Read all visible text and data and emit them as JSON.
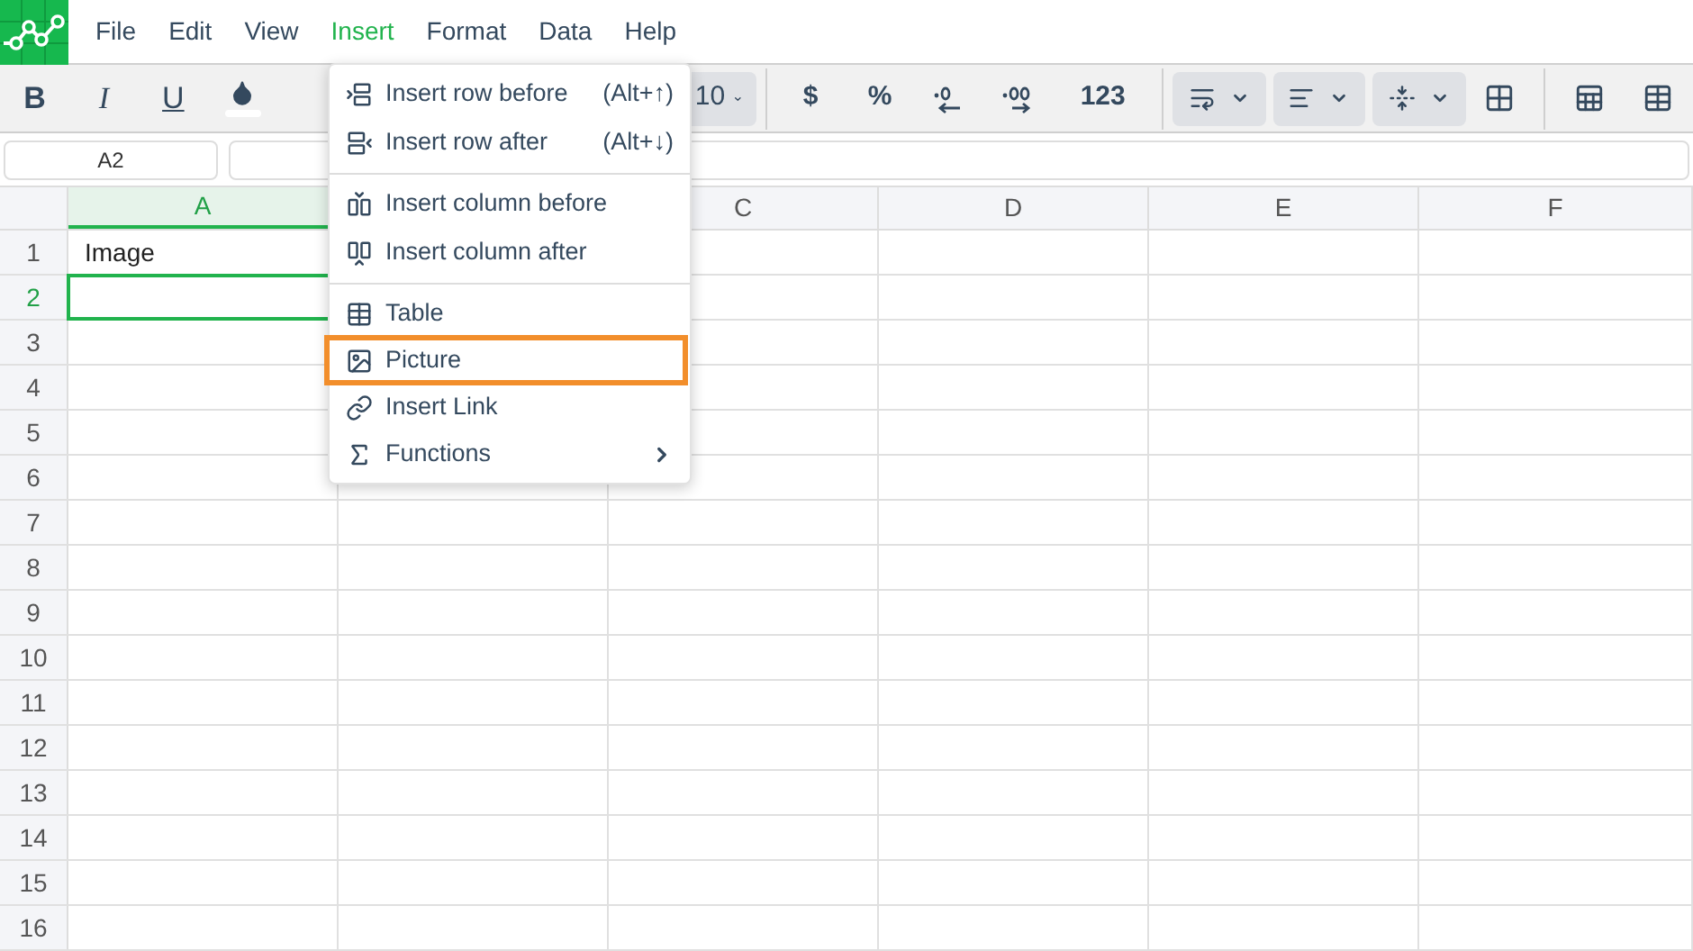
{
  "menubar": [
    {
      "label": "File",
      "selected": false
    },
    {
      "label": "Edit",
      "selected": false
    },
    {
      "label": "View",
      "selected": false
    },
    {
      "label": "Insert",
      "selected": true
    },
    {
      "label": "Format",
      "selected": false
    },
    {
      "label": "Data",
      "selected": false
    },
    {
      "label": "Help",
      "selected": false
    }
  ],
  "toolbar": [
    {
      "kind": "bold",
      "label": "B"
    },
    {
      "kind": "italic",
      "label": "I"
    },
    {
      "kind": "underline",
      "label": "U"
    },
    {
      "kind": "fill"
    },
    {
      "kind": "font-size",
      "label": "10"
    },
    {
      "kind": "separator"
    },
    {
      "kind": "currency",
      "label": "$"
    },
    {
      "kind": "percent",
      "label": "%"
    },
    {
      "kind": "decrease-decimals"
    },
    {
      "kind": "increase-decimals"
    },
    {
      "kind": "number-format",
      "label": "123"
    },
    {
      "kind": "separator"
    },
    {
      "kind": "text-wrap"
    },
    {
      "kind": "align"
    },
    {
      "kind": "valign"
    },
    {
      "kind": "borders"
    },
    {
      "kind": "separator"
    },
    {
      "kind": "merge"
    },
    {
      "kind": "table"
    }
  ],
  "name_box": "A2",
  "columns": [
    {
      "label": "A",
      "selected": true
    },
    {},
    {
      "label": "C",
      "selected": false
    },
    {
      "label": "D",
      "selected": false
    },
    {
      "label": "E",
      "selected": false
    },
    {
      "label": "F",
      "selected": false
    }
  ],
  "rows": [
    {
      "label": "1",
      "selected": false,
      "cells": [
        "Image"
      ]
    },
    {
      "label": "2",
      "selected": true
    },
    {
      "label": "3",
      "selected": false
    },
    {
      "label": "4",
      "selected": false
    },
    {
      "label": "5",
      "selected": false
    },
    {
      "label": "6",
      "selected": false
    },
    {
      "label": "7",
      "selected": false
    },
    {
      "label": "8",
      "selected": false
    },
    {
      "label": "9",
      "selected": false
    },
    {
      "label": "10",
      "selected": false
    },
    {
      "label": "11",
      "selected": false
    },
    {
      "label": "12",
      "selected": false
    },
    {
      "label": "13",
      "selected": false
    },
    {
      "label": "14",
      "selected": false
    },
    {
      "label": "15",
      "selected": false
    },
    {
      "label": "16",
      "selected": false
    }
  ],
  "insert_menu": [
    [
      {
        "kind": "row-before",
        "label": "Insert row before",
        "shortcut": "(Alt+↑)",
        "highlighted": false
      },
      {
        "kind": "row-after",
        "label": "Insert row after",
        "shortcut": "(Alt+↓)",
        "highlighted": false
      }
    ],
    [
      {
        "kind": "column-before",
        "label": "Insert column before",
        "highlighted": false
      },
      {
        "kind": "column-after",
        "label": "Insert column after",
        "highlighted": false
      }
    ],
    [
      {
        "kind": "table",
        "label": "Table",
        "highlighted": false
      },
      {
        "kind": "picture",
        "label": "Picture",
        "highlighted": true
      },
      {
        "kind": "link",
        "label": "Insert Link",
        "highlighted": false
      },
      {
        "kind": "functions",
        "label": "Functions",
        "submenu": true,
        "highlighted": false
      }
    ]
  ]
}
